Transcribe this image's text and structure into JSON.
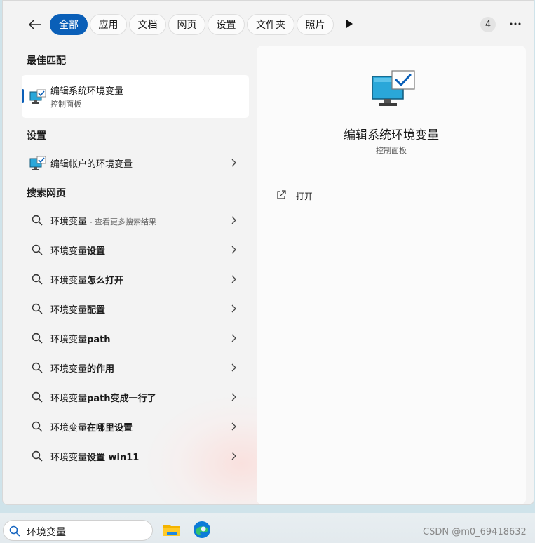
{
  "filters": {
    "tabs": [
      {
        "label": "全部",
        "active": true
      },
      {
        "label": "应用",
        "active": false
      },
      {
        "label": "文档",
        "active": false
      },
      {
        "label": "网页",
        "active": false
      },
      {
        "label": "设置",
        "active": false
      },
      {
        "label": "文件夹",
        "active": false
      },
      {
        "label": "照片",
        "active": false
      }
    ],
    "count": "4"
  },
  "sections": {
    "best_match": "最佳匹配",
    "settings": "设置",
    "web_search": "搜索网页"
  },
  "best_match": {
    "title": "编辑系统环境变量",
    "subtitle": "控制面板"
  },
  "settings_items": [
    {
      "label": "编辑帐户的环境变量"
    }
  ],
  "web_results": [
    {
      "query": "环境变量",
      "suffix": "",
      "hint": " - 查看更多搜索结果"
    },
    {
      "query": "环境变量",
      "suffix": "设置",
      "hint": ""
    },
    {
      "query": "环境变量",
      "suffix": "怎么打开",
      "hint": ""
    },
    {
      "query": "环境变量",
      "suffix": "配置",
      "hint": ""
    },
    {
      "query": "环境变量",
      "suffix": "path",
      "hint": ""
    },
    {
      "query": "环境变量",
      "suffix": "的作用",
      "hint": ""
    },
    {
      "query": "环境变量",
      "suffix": "path变成一行了",
      "hint": ""
    },
    {
      "query": "环境变量",
      "suffix": "在哪里设置",
      "hint": ""
    },
    {
      "query": "环境变量",
      "suffix": "设置 win11",
      "hint": ""
    }
  ],
  "preview": {
    "title": "编辑系统环境变量",
    "subtitle": "控制面板",
    "action_label": "打开"
  },
  "taskbar": {
    "search_text": "环境变量",
    "watermark": "CSDN @m0_69418632"
  },
  "colors": {
    "accent": "#0a5fb8",
    "window_bg": "#f3f3f3",
    "panel_bg": "#fbfbfb"
  },
  "icons": {
    "back": "back-arrow-icon",
    "more": "more-icon",
    "search": "search-icon",
    "monitor": "monitor-checkmark-icon",
    "open": "open-external-icon",
    "chevron": "chevron-right-icon",
    "folder": "file-explorer-icon",
    "edge": "edge-browser-icon"
  }
}
